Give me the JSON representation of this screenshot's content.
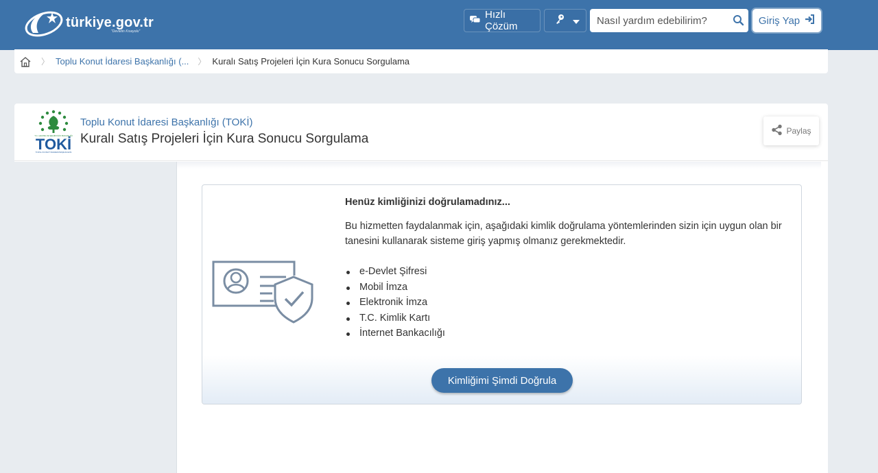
{
  "header": {
    "logo_text": "türkiye.gov.tr",
    "logo_tagline": "\"Devletin Kısayolu\"",
    "quick_solution_label": "Hızlı Çözüm",
    "search_placeholder": "Nasıl yardım edebilirim?",
    "login_label": "Giriş Yap",
    "icons": {
      "quick": "chat-bubbles-icon",
      "key": "key-icon",
      "search": "search-icon",
      "login": "sign-in-icon"
    }
  },
  "breadcrumb": {
    "home_icon": "home-icon",
    "items": [
      "Toplu Konut İdaresi Başkanlığı (...",
      "Kuralı Satış Projeleri İçin Kura Sonucu Sorgulama"
    ]
  },
  "org": {
    "name": "Toplu Konut İdaresi Başkanlığı (TOKİ)",
    "page_title": "Kuralı Satış Projeleri İçin Kura Sonucu Sorgulama",
    "logo_text": "TOKİ",
    "share_label": "Paylaş"
  },
  "auth": {
    "title": "Henüz kimliğinizi doğrulamadınız...",
    "description": "Bu hizmetten faydalanmak için, aşağıdaki kimlik doğrulama yöntemlerinden sizin için uygun olan bir tanesini kullanarak sisteme giriş yapmış olmanız gerekmektedir.",
    "methods": [
      "e-Devlet Şifresi",
      "Mobil İmza",
      "Elektronik İmza",
      "T.C. Kimlik Kartı",
      "İnternet Bankacılığı"
    ],
    "verify_button": "Kimliğimi Şimdi Doğrula"
  },
  "colors": {
    "primary": "#3d73aa",
    "background": "#e8ecf0",
    "toki_green": "#2e8b3f",
    "toki_blue": "#1f5a9e"
  }
}
